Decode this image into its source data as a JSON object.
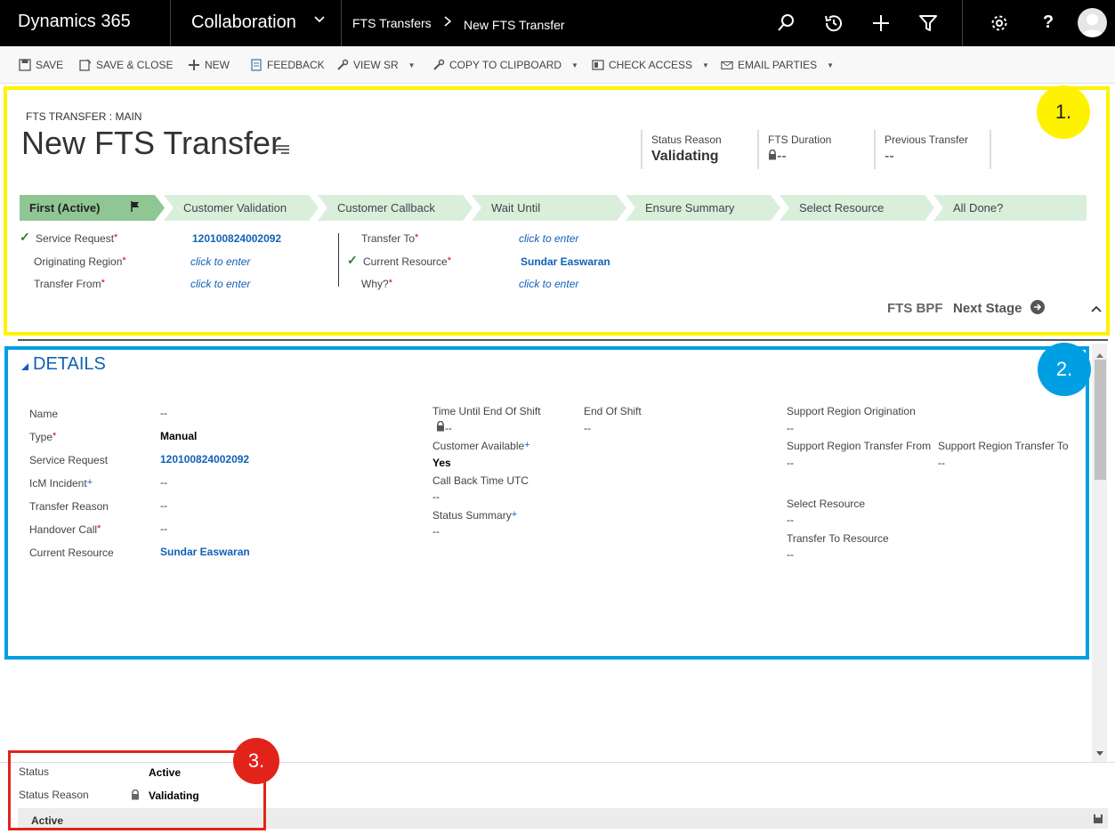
{
  "nav": {
    "brand": "Dynamics 365",
    "area": "Collaboration",
    "breadcrumb_entity": "FTS Transfers",
    "breadcrumb_current": "New FTS Transfer",
    "icons": [
      "search-icon",
      "recent-icon",
      "add-icon",
      "filter-icon",
      "settings-icon",
      "help-icon",
      "user-avatar"
    ]
  },
  "toolbar": {
    "save": "SAVE",
    "save_close": "SAVE & CLOSE",
    "new": "NEW",
    "feedback": "FEEDBACK",
    "view_sr": "VIEW SR",
    "copy_clipboard": "COPY TO CLIPBOARD",
    "check_access": "CHECK ACCESS",
    "email_parties": "EMAIL PARTIES"
  },
  "annotations": {
    "one": "1.",
    "two": "2.",
    "three": "3.",
    "colors": {
      "yellow": "#fff200",
      "blue": "#009fe3",
      "red": "#e2231a"
    }
  },
  "header": {
    "form_kind": "FTS TRANSFER : MAIN",
    "title": "New FTS Transfer",
    "fields": [
      {
        "label": "Status Reason",
        "value": "Validating"
      },
      {
        "label": "FTS Duration",
        "value": "--"
      },
      {
        "label": "Previous Transfer",
        "value": "--"
      }
    ]
  },
  "bpf": {
    "stages": [
      "First (Active)",
      "Customer Validation",
      "Customer Callback",
      "Wait Until",
      "Ensure Summary",
      "Select Resource",
      "All Done?"
    ],
    "active_stage": "First (Active)",
    "left_fields": [
      {
        "label": "Service Request",
        "value": "120100824002092",
        "complete": true
      },
      {
        "label": "Originating Region",
        "value": "click to enter",
        "complete": false
      },
      {
        "label": "Transfer From",
        "value": "click to enter",
        "complete": false
      }
    ],
    "right_fields": [
      {
        "label": "Transfer To",
        "value": "click to enter",
        "complete": false
      },
      {
        "label": "Current Resource",
        "value": "Sundar Easwaran",
        "complete": true
      },
      {
        "label": "Why?",
        "value": "click to enter",
        "complete": false
      }
    ],
    "process_name": "FTS BPF",
    "next_stage": "Next Stage"
  },
  "details": {
    "title": "DETAILS",
    "col1": [
      {
        "label": "Name",
        "value": "--"
      },
      {
        "label": "Type",
        "value": "Manual"
      },
      {
        "label": "Service Request",
        "value": "120100824002092"
      },
      {
        "label": "IcM Incident",
        "value": "--"
      },
      {
        "label": "Transfer Reason",
        "value": "--"
      },
      {
        "label": "Handover Call",
        "value": "--"
      },
      {
        "label": "Current Resource",
        "value": "Sundar Easwaran"
      }
    ],
    "col2": [
      {
        "label": "Time Until End Of Shift",
        "value": "--"
      },
      {
        "label": "Customer Available",
        "value": "Yes"
      },
      {
        "label": "Call Back Time UTC",
        "value": "--"
      },
      {
        "label": "Status Summary",
        "value": "--"
      }
    ],
    "col3": [
      {
        "label": "End Of Shift",
        "value": "--"
      }
    ],
    "col4": [
      {
        "label": "Support Region Origination",
        "value": "--"
      },
      {
        "label": "Support Region Transfer From",
        "value": "--"
      },
      {
        "label": "Select Resource",
        "value": "--"
      },
      {
        "label": "Transfer To Resource",
        "value": "--"
      }
    ],
    "col5": [
      {
        "label": "Support Region Transfer To",
        "value": "--"
      }
    ]
  },
  "footer": {
    "status_label": "Status",
    "status_value": "Active",
    "reason_label": "Status Reason",
    "reason_value": "Validating",
    "bar_status": "Active"
  }
}
